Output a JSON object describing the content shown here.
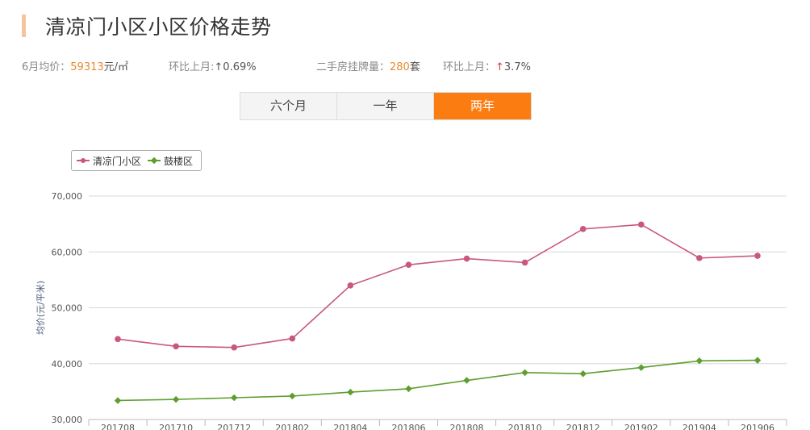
{
  "header": {
    "title": "清凉门小区小区价格走势"
  },
  "stats": {
    "avg_label": "6月均价：",
    "avg_value": "59313",
    "avg_unit": "元/㎡",
    "mom_label": "环比上月:",
    "mom_arrow": "↑",
    "mom_value": "0.69%",
    "listings_label": "二手房挂牌量：",
    "listings_value": "280",
    "listings_unit": "套",
    "mom2_label": "环比上月：",
    "mom2_arrow": "↑",
    "mom2_value": "3.7%"
  },
  "tabs": [
    {
      "label": "六个月",
      "active": false
    },
    {
      "label": "一年",
      "active": false
    },
    {
      "label": "两年",
      "active": true
    }
  ],
  "colors": {
    "series1": "#c9587a",
    "series2": "#5e9e2e",
    "accent": "#fb7d12",
    "grid": "#d8d8d8"
  },
  "chart_data": {
    "type": "line",
    "title": "",
    "xlabel": "",
    "ylabel": "均价(元/平米)",
    "categories": [
      "201708",
      "201710",
      "201712",
      "201802",
      "201804",
      "201806",
      "201808",
      "201810",
      "201812",
      "201902",
      "201904",
      "201906"
    ],
    "ylim": [
      30000,
      70000
    ],
    "yticks": [
      "30,000",
      "40,000",
      "50,000",
      "60,000",
      "70,000"
    ],
    "ytick_values": [
      30000,
      40000,
      50000,
      60000,
      70000
    ],
    "grid": true,
    "legend_position": "top-left",
    "series": [
      {
        "name": "清凉门小区",
        "values": [
          44400,
          43100,
          42900,
          44500,
          54000,
          57700,
          58800,
          58100,
          64100,
          64900,
          58900,
          59300
        ]
      },
      {
        "name": "鼓楼区",
        "values": [
          33400,
          33600,
          33900,
          34200,
          34900,
          35500,
          37000,
          38400,
          38200,
          39300,
          40500,
          40600
        ]
      }
    ]
  }
}
